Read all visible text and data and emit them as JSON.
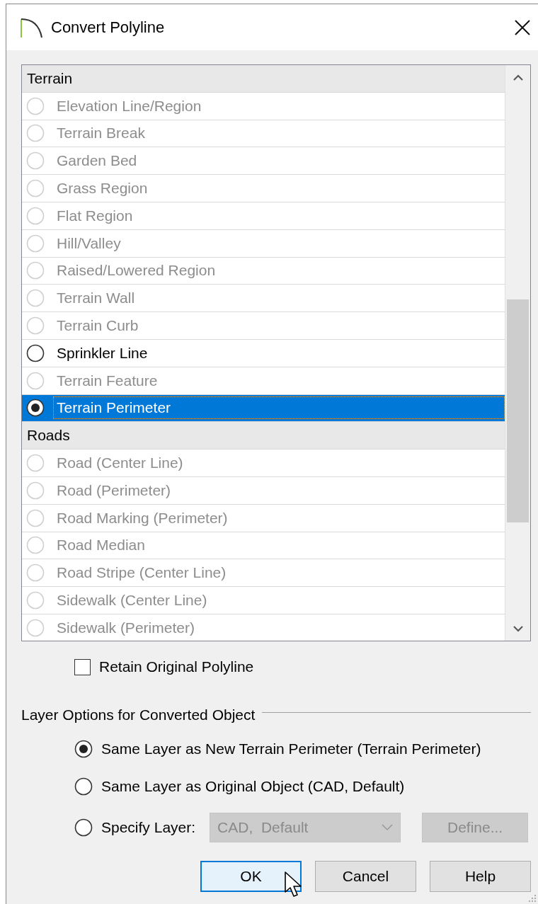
{
  "window": {
    "title": "Convert Polyline"
  },
  "list": {
    "items": [
      {
        "kind": "header",
        "label": "Terrain"
      },
      {
        "kind": "option",
        "label": "Elevation Line/Region",
        "disabled": true,
        "selected": false
      },
      {
        "kind": "option",
        "label": "Terrain Break",
        "disabled": true,
        "selected": false
      },
      {
        "kind": "option",
        "label": "Garden Bed",
        "disabled": true,
        "selected": false
      },
      {
        "kind": "option",
        "label": "Grass Region",
        "disabled": true,
        "selected": false
      },
      {
        "kind": "option",
        "label": "Flat Region",
        "disabled": true,
        "selected": false
      },
      {
        "kind": "option",
        "label": "Hill/Valley",
        "disabled": true,
        "selected": false
      },
      {
        "kind": "option",
        "label": "Raised/Lowered Region",
        "disabled": true,
        "selected": false
      },
      {
        "kind": "option",
        "label": "Terrain Wall",
        "disabled": true,
        "selected": false
      },
      {
        "kind": "option",
        "label": "Terrain Curb",
        "disabled": true,
        "selected": false
      },
      {
        "kind": "option",
        "label": "Sprinkler Line",
        "disabled": false,
        "selected": false
      },
      {
        "kind": "option",
        "label": "Terrain Feature",
        "disabled": true,
        "selected": false
      },
      {
        "kind": "option",
        "label": "Terrain Perimeter",
        "disabled": false,
        "selected": true
      },
      {
        "kind": "header",
        "label": "Roads"
      },
      {
        "kind": "option",
        "label": "Road (Center Line)",
        "disabled": true,
        "selected": false
      },
      {
        "kind": "option",
        "label": "Road (Perimeter)",
        "disabled": true,
        "selected": false
      },
      {
        "kind": "option",
        "label": "Road Marking (Perimeter)",
        "disabled": true,
        "selected": false
      },
      {
        "kind": "option",
        "label": "Road Median",
        "disabled": true,
        "selected": false
      },
      {
        "kind": "option",
        "label": "Road Stripe (Center Line)",
        "disabled": true,
        "selected": false
      },
      {
        "kind": "option",
        "label": "Sidewalk (Center Line)",
        "disabled": true,
        "selected": false
      },
      {
        "kind": "option",
        "label": "Sidewalk (Perimeter)",
        "disabled": true,
        "selected": false
      }
    ]
  },
  "retain_original": {
    "label": "Retain Original Polyline",
    "checked": false
  },
  "layer_options": {
    "title": "Layer Options for Converted Object",
    "choices": [
      {
        "label": "Same Layer as New Terrain Perimeter (Terrain Perimeter)",
        "selected": true
      },
      {
        "label": "Same Layer as Original Object (CAD,  Default)",
        "selected": false
      },
      {
        "label": "Specify Layer:",
        "selected": false
      }
    ],
    "layer_dropdown": {
      "value": "CAD,  Default",
      "disabled": true
    },
    "define_button": {
      "label": "Define...",
      "disabled": true
    }
  },
  "buttons": [
    {
      "label": "OK",
      "focused": true
    },
    {
      "label": "Cancel",
      "focused": false
    },
    {
      "label": "Help",
      "focused": false
    }
  ]
}
